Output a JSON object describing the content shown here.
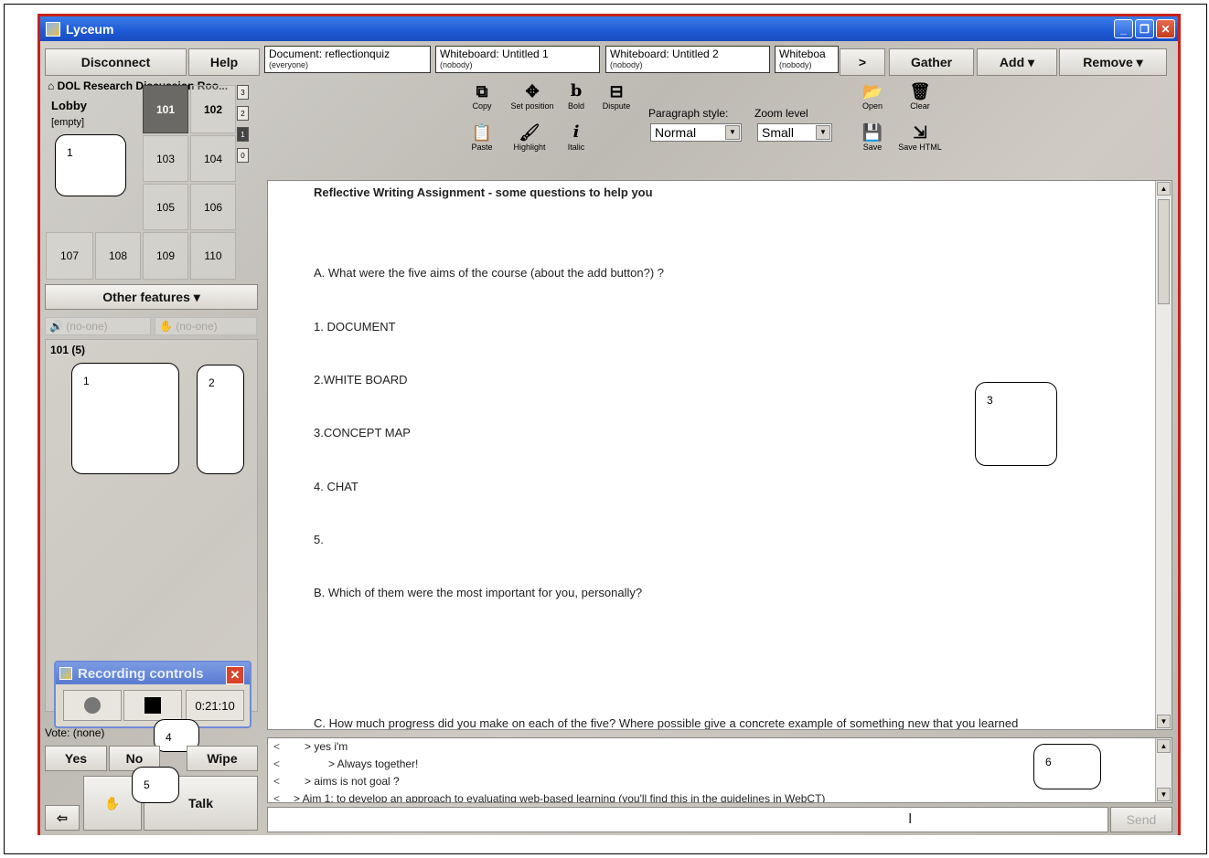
{
  "window": {
    "title": "Lyceum"
  },
  "top_buttons": {
    "disconnect": "Disconnect",
    "help": "Help",
    "more": ">",
    "gather": "Gather",
    "add": "Add ▾",
    "remove": "Remove ▾"
  },
  "tabs": [
    {
      "title": "Document: reflectionquiz",
      "sub": "(everyone)"
    },
    {
      "title": "Whiteboard: Untitled 1",
      "sub": "(nobody)"
    },
    {
      "title": "Whiteboard: Untitled 2",
      "sub": "(nobody)"
    },
    {
      "title": "Whiteboa",
      "sub": "(nobody)"
    }
  ],
  "building": {
    "name": "DOL Research Discussion Roo...",
    "lobby": {
      "label": "Lobby",
      "status": "[empty]"
    },
    "rooms": [
      "101",
      "102",
      "103",
      "104",
      "105",
      "106",
      "107",
      "108",
      "109",
      "110"
    ],
    "active_room": "101",
    "floors": [
      "3",
      "2",
      "1",
      "0"
    ],
    "selected_floor": "1"
  },
  "other_features": "Other features ▾",
  "speaker": {
    "audio": "(no-one)",
    "hand": "(no-one)"
  },
  "room_panel": {
    "title": "101  (5)"
  },
  "annotations": {
    "b1": "1",
    "b2": "2",
    "b3": "3",
    "b4": "4",
    "b5": "5",
    "b6": "6",
    "lobby_b": "1"
  },
  "recording": {
    "title": "Recording controls",
    "time": "0:21:10"
  },
  "vote": {
    "label": "Vote: (none)",
    "yes": "Yes",
    "no": "No",
    "wipe": "Wipe"
  },
  "talk": "Talk",
  "toolbar": {
    "copy": "Copy",
    "set_position": "Set position",
    "bold": "Bold",
    "dispute": "Dispute",
    "paste": "Paste",
    "highlight": "Highlight",
    "italic": "Italic",
    "paragraph_label": "Paragraph style:",
    "paragraph_value": "Normal",
    "zoom_label": "Zoom level",
    "zoom_value": "Small",
    "open": "Open",
    "clear": "Clear",
    "save": "Save",
    "save_html": "Save HTML"
  },
  "document": {
    "lines": [
      "Reflective Writing Assignment - some questions to help you",
      "A. What were the five aims of the course (about the add button?) ?",
      "1. DOCUMENT",
      "2.WHITE BOARD",
      "3.CONCEPT MAP",
      "4. CHAT",
      "5.",
      "B. Which of them were the most important for you, personally?",
      "C. How much progress did you make on each of the five? Where possible give a concrete example of something new that you learned"
    ]
  },
  "chat": {
    "messages": [
      {
        "prefix": "<",
        "text": "> yes i'm"
      },
      {
        "prefix": "<",
        "text": "> Always together!"
      },
      {
        "prefix": "<",
        "text": "> aims is not goal ?"
      },
      {
        "prefix": "<",
        "text": "> Aim 1: to develop an approach to evaluating web-based learning (you'll find this in the guidelines in WebCT)"
      }
    ],
    "send": "Send"
  }
}
